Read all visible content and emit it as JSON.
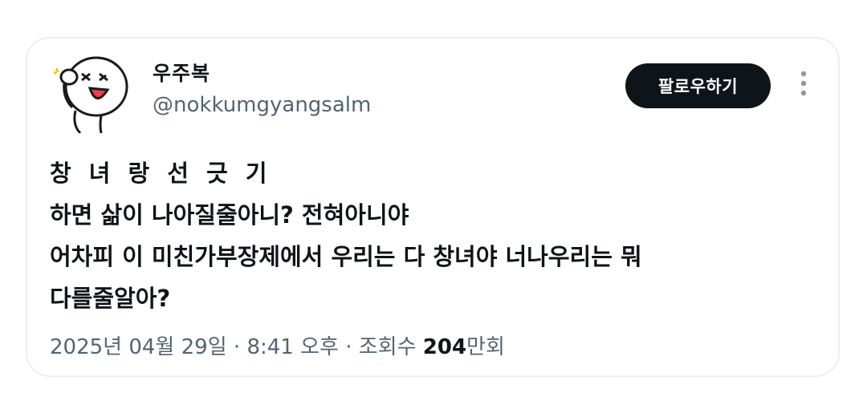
{
  "author": {
    "display_name": "우주복",
    "handle": "@nokkumgyangsalm",
    "avatar_icon": "cartoon-face-avatar-icon"
  },
  "actions": {
    "follow_label": "팔로우하기",
    "more_icon": "more-vertical-icon"
  },
  "tweet": {
    "lines": [
      "창 녀 랑 선 긋 기",
      "하면 삶이 나아질줄아니? 전혀아니야",
      "어차피 이 미친가부장제에서 우리는 다 창녀야 너나우리는 뭐",
      "다를줄알아?"
    ]
  },
  "meta": {
    "date": "2025년 04월 29일",
    "separator": "·",
    "time": "8:41 오후",
    "views_prefix": "조회수",
    "views_count": "204",
    "views_unit": "만회"
  },
  "colors": {
    "text_primary": "#0f1419",
    "text_secondary": "#536471",
    "button_bg": "#0f1419",
    "border": "#eceff1"
  }
}
